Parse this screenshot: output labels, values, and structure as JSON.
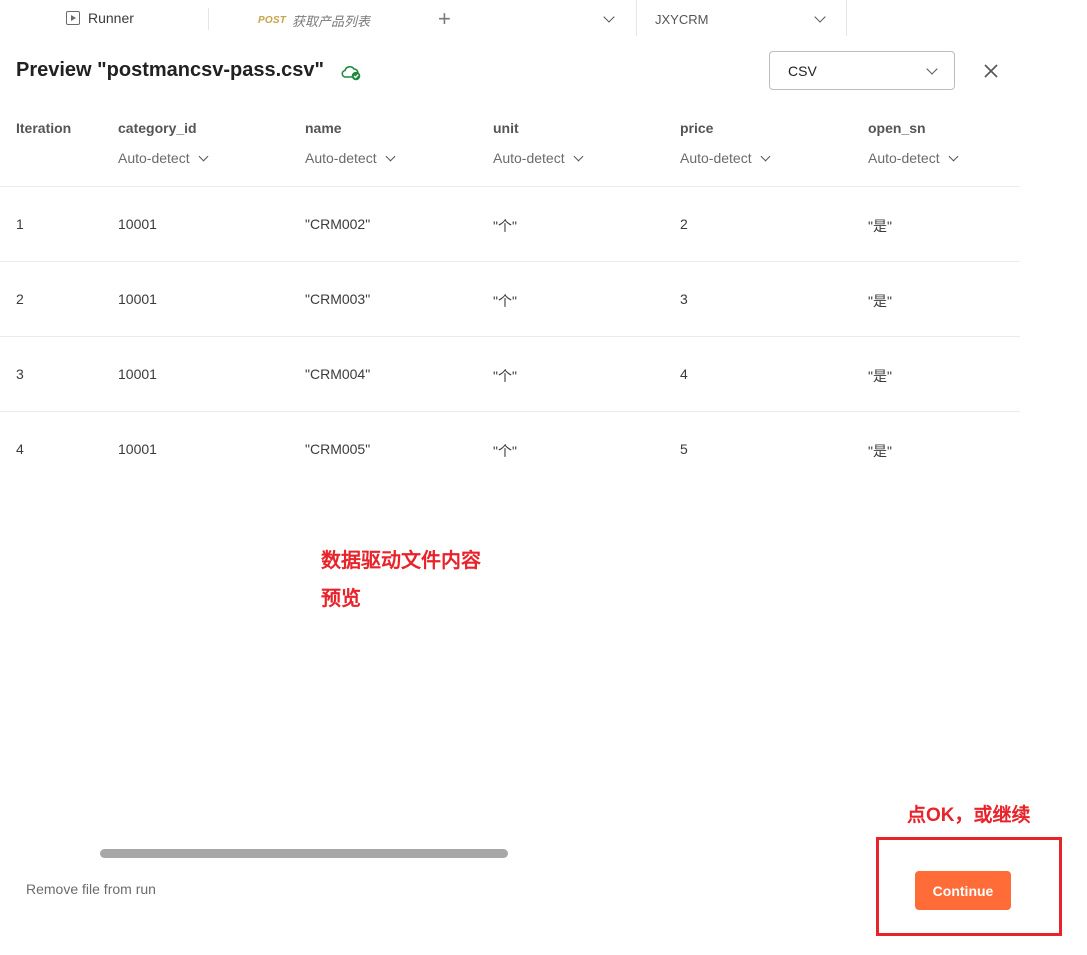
{
  "topbar": {
    "runner_label": "Runner",
    "request_method": "POST",
    "request_name": "获取产品列表",
    "environment": "JXYCRM"
  },
  "dialog": {
    "title": "Preview \"postmancsv-pass.csv\"",
    "format_value": "CSV"
  },
  "table": {
    "columns": [
      {
        "label": "Iteration",
        "type": ""
      },
      {
        "label": "category_id",
        "type": "Auto-detect"
      },
      {
        "label": "name",
        "type": "Auto-detect"
      },
      {
        "label": "unit",
        "type": "Auto-detect"
      },
      {
        "label": "price",
        "type": "Auto-detect"
      },
      {
        "label": "open_sn",
        "type": "Auto-detect"
      }
    ],
    "rows": [
      [
        "1",
        "10001",
        "\"CRM002\"",
        "\"个\"",
        "2",
        "\"是\""
      ],
      [
        "2",
        "10001",
        "\"CRM003\"",
        "\"个\"",
        "3",
        "\"是\""
      ],
      [
        "3",
        "10001",
        "\"CRM004\"",
        "\"个\"",
        "4",
        "\"是\""
      ],
      [
        "4",
        "10001",
        "\"CRM005\"",
        "\"个\"",
        "5",
        "\"是\""
      ]
    ]
  },
  "annotations": {
    "preview_note_line1": "数据驱动文件内容",
    "preview_note_line2": "预览",
    "continue_note": "点OK，或继续"
  },
  "footer": {
    "remove_label": "Remove file from run",
    "continue_label": "Continue"
  },
  "colors": {
    "accent": "#ff6c37",
    "annotation": "#e8232a",
    "cloud_ok": "#1a8a3c"
  }
}
